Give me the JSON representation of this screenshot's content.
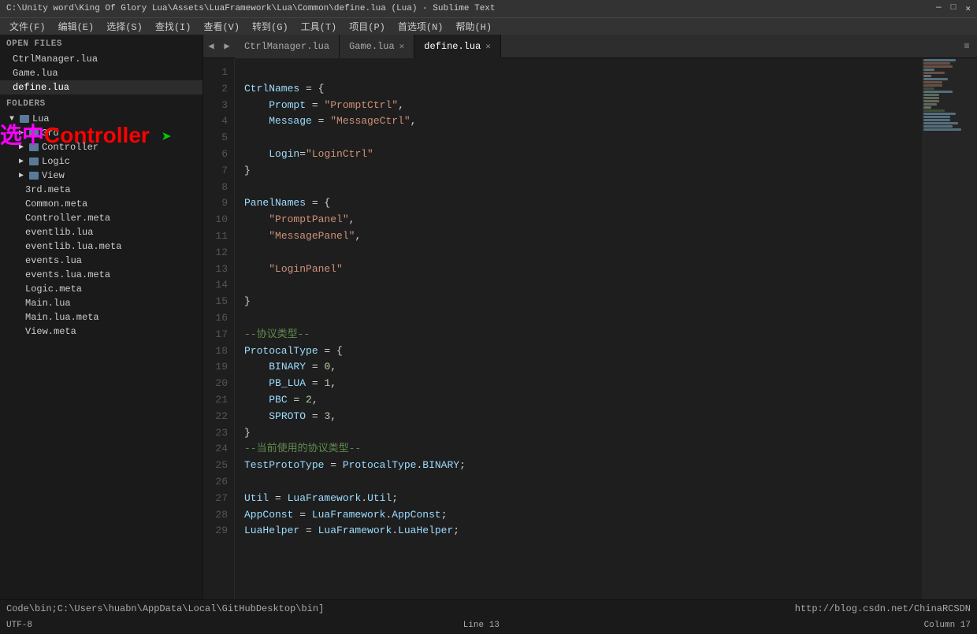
{
  "titlebar": {
    "title": "C:\\Unity word\\King Of Glory Lua\\Assets\\LuaFramework\\Lua\\Common\\define.lua (Lua) - Sublime Text",
    "minimize": "—",
    "maximize": "□",
    "close": "✕"
  },
  "menubar": {
    "items": [
      "文件(F)",
      "编辑(E)",
      "选择(S)",
      "查找(I)",
      "查看(V)",
      "转到(G)",
      "工具(T)",
      "项目(P)",
      "首选项(N)",
      "帮助(H)"
    ]
  },
  "sidebar": {
    "open_files_label": "OPEN FILES",
    "open_files": [
      {
        "name": "CtrlManager.lua",
        "active": false
      },
      {
        "name": "Game.lua",
        "active": false
      },
      {
        "name": "define.lua",
        "active": true
      }
    ],
    "folders_label": "FOLDERS",
    "tree": [
      {
        "label": "Lua",
        "indent": 0,
        "type": "folder",
        "expanded": true
      },
      {
        "label": "3rd",
        "indent": 1,
        "type": "folder",
        "expanded": false
      },
      {
        "label": "Controller",
        "indent": 1,
        "type": "folder",
        "expanded": false
      },
      {
        "label": "Logic",
        "indent": 1,
        "type": "folder",
        "expanded": false
      },
      {
        "label": "View",
        "indent": 1,
        "type": "folder",
        "expanded": false
      },
      {
        "label": "3rd.meta",
        "indent": 2,
        "type": "file"
      },
      {
        "label": "Common.meta",
        "indent": 2,
        "type": "file"
      },
      {
        "label": "Controller.meta",
        "indent": 2,
        "type": "file"
      },
      {
        "label": "eventlib.lua",
        "indent": 2,
        "type": "file"
      },
      {
        "label": "eventlib.lua.meta",
        "indent": 2,
        "type": "file"
      },
      {
        "label": "events.lua",
        "indent": 2,
        "type": "file"
      },
      {
        "label": "events.lua.meta",
        "indent": 2,
        "type": "file"
      },
      {
        "label": "Logic.meta",
        "indent": 2,
        "type": "file"
      },
      {
        "label": "Main.lua",
        "indent": 2,
        "type": "file"
      },
      {
        "label": "Main.lua.meta",
        "indent": 2,
        "type": "file"
      },
      {
        "label": "View.meta",
        "indent": 2,
        "type": "file"
      }
    ]
  },
  "tabs": {
    "nav_prev": "◀",
    "nav_next": "▶",
    "items": [
      {
        "label": "CtrlManager.lua",
        "active": false,
        "closable": false
      },
      {
        "label": "Game.lua",
        "active": false,
        "closable": true
      },
      {
        "label": "define.lua",
        "active": true,
        "closable": true
      }
    ],
    "menu_btn": "≡"
  },
  "code": {
    "lines": [
      {
        "num": 1,
        "content": ""
      },
      {
        "num": 2,
        "content": "CtrlNames = {"
      },
      {
        "num": 3,
        "content": "    Prompt = \"PromptCtrl\","
      },
      {
        "num": 4,
        "content": "    Message = \"MessageCtrl\","
      },
      {
        "num": 5,
        "content": ""
      },
      {
        "num": 6,
        "content": "    Login=\"LoginCtrl\""
      },
      {
        "num": 7,
        "content": "}"
      },
      {
        "num": 8,
        "content": ""
      },
      {
        "num": 9,
        "content": "PanelNames = {"
      },
      {
        "num": 10,
        "content": "    \"PromptPanel\","
      },
      {
        "num": 11,
        "content": "    \"MessagePanel\","
      },
      {
        "num": 12,
        "content": ""
      },
      {
        "num": 13,
        "content": "    \"LoginPanel\""
      },
      {
        "num": 14,
        "content": ""
      },
      {
        "num": 15,
        "content": "}"
      },
      {
        "num": 16,
        "content": ""
      },
      {
        "num": 17,
        "content": "--协议类型--"
      },
      {
        "num": 18,
        "content": "ProtocalType = {"
      },
      {
        "num": 19,
        "content": "    BINARY = 0,"
      },
      {
        "num": 20,
        "content": "    PB_LUA = 1,"
      },
      {
        "num": 21,
        "content": "    PBC = 2,"
      },
      {
        "num": 22,
        "content": "    SPROTO = 3,"
      },
      {
        "num": 23,
        "content": "}"
      },
      {
        "num": 24,
        "content": "--当前使用的协议类型--"
      },
      {
        "num": 25,
        "content": "TestProtoType = ProtocalType.BINARY;"
      },
      {
        "num": 26,
        "content": ""
      },
      {
        "num": 27,
        "content": "Util = LuaFramework.Util;"
      },
      {
        "num": 28,
        "content": "AppConst = LuaFramework.AppConst;"
      },
      {
        "num": 29,
        "content": "LuaHelper = LuaFramework.LuaHelper;"
      }
    ]
  },
  "annotation": {
    "text1": "选中",
    "text2": "Controller",
    "arrow": "➤"
  },
  "statusbar": {
    "left": "Code\\bin;C:\\Users\\huabn\\AppData\\Local\\GitHubDesktop\\bin]",
    "right": "http://blog.csdn.net/ChinaRCSDN"
  },
  "commandbar": {
    "encoding": "UTF-8",
    "line": "Line 13",
    "column": "Column 17"
  }
}
